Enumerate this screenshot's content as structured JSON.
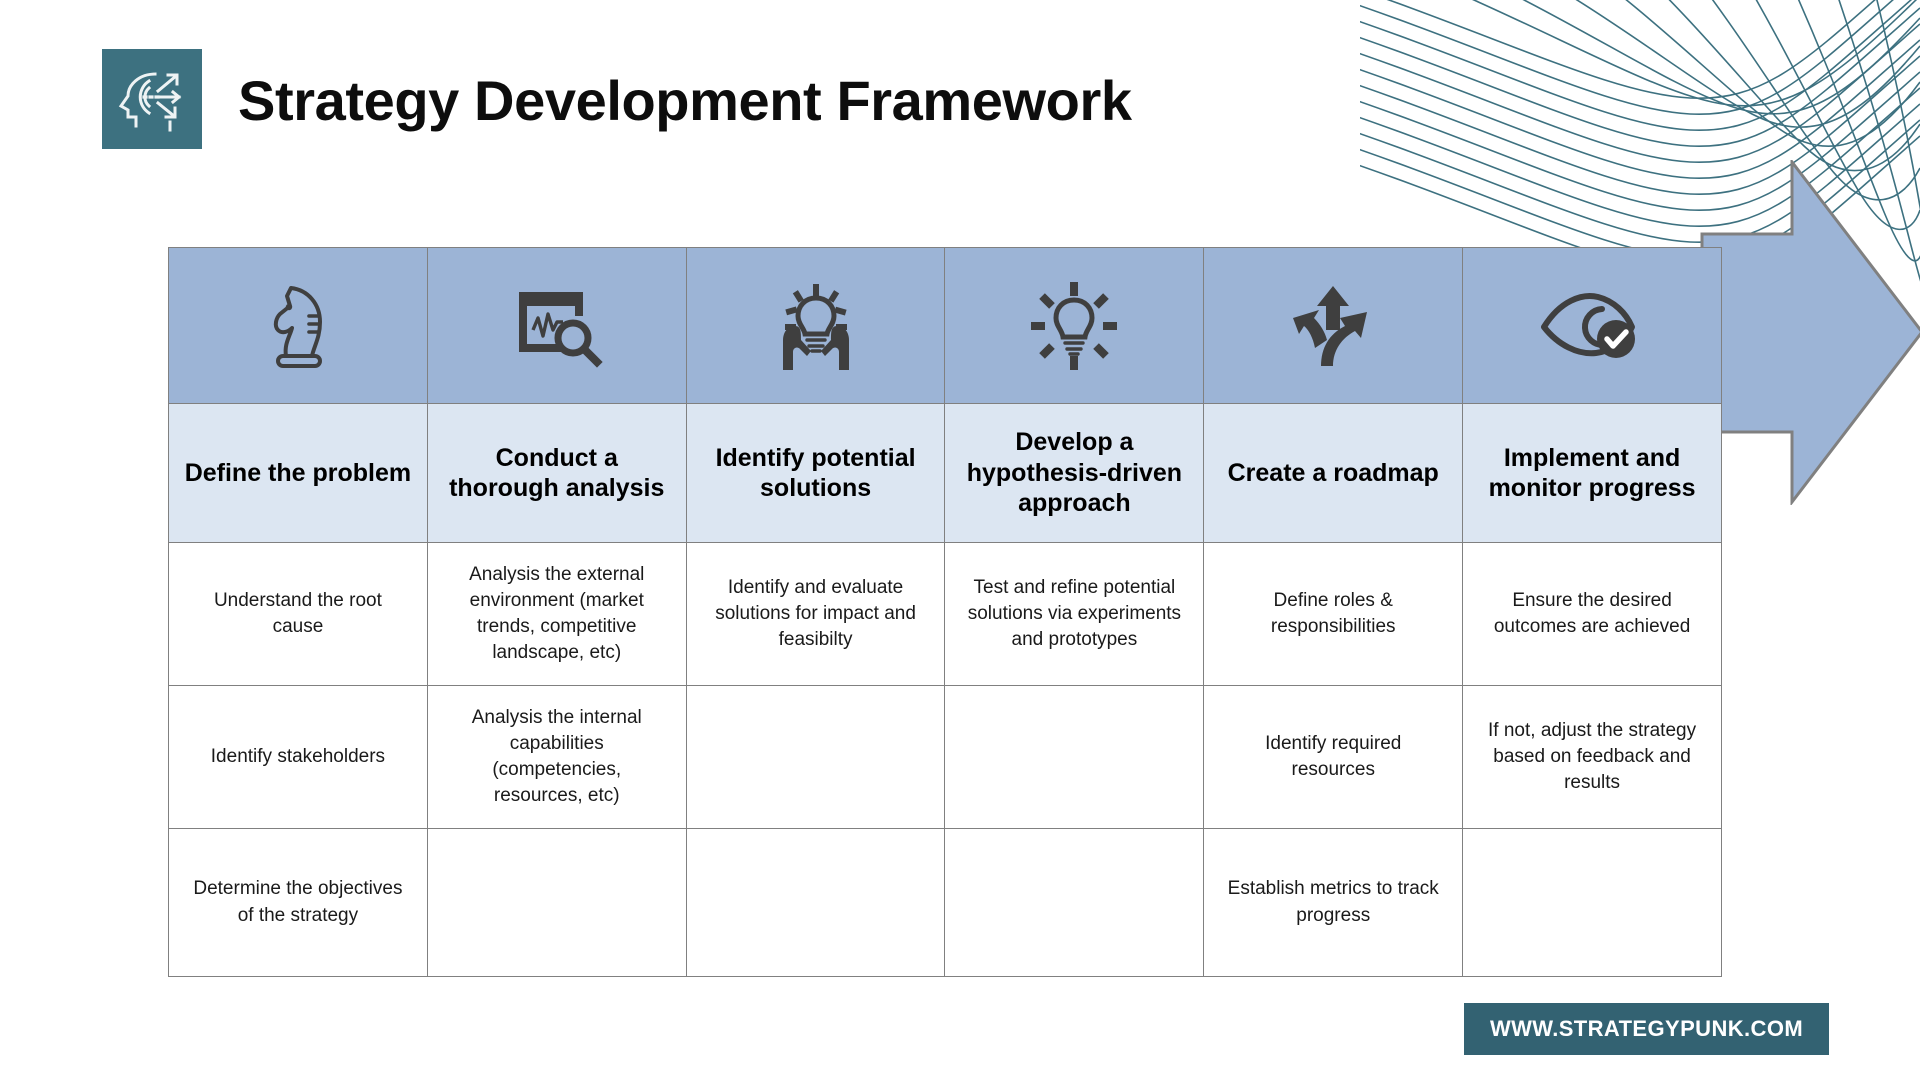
{
  "header": {
    "title": "Strategy Development Framework",
    "logo_icon": "head-arrows-icon",
    "logo_bg_color": "#3d7180"
  },
  "decoration": {
    "waves_icon": "wave-lines-decoration",
    "waves_color": "#3d7180",
    "arrow_icon": "right-arrow-shape",
    "arrow_color": "#9cb4d6",
    "arrow_border_color": "#808080"
  },
  "table": {
    "icon_row_bg": "#9cb4d6",
    "header_row_bg": "#dce6f2",
    "border_color": "#808080",
    "columns": [
      {
        "icon": "chess-knight-icon",
        "header": "Define the problem",
        "items": [
          "Understand the root cause",
          "Identify stakeholders",
          "Determine the objectives of the strategy"
        ]
      },
      {
        "icon": "chart-magnifier-icon",
        "header": "Conduct a thorough analysis",
        "items": [
          "Analysis the external environment (market trends, competitive landscape, etc)",
          "Analysis the internal capabilities (competencies, resources, etc)",
          ""
        ]
      },
      {
        "icon": "hands-lightbulb-icon",
        "header": "Identify potential solutions",
        "items": [
          "Identify and evaluate solutions for impact and feasibilty",
          "",
          ""
        ]
      },
      {
        "icon": "lightbulb-rays-icon",
        "header": "Develop a hypothesis-driven approach",
        "items": [
          "Test and refine potential solutions via experiments and prototypes",
          "",
          ""
        ]
      },
      {
        "icon": "three-way-arrows-icon",
        "header": "Create a roadmap",
        "items": [
          "Define roles & responsibilities",
          "Identify required resources",
          "Establish metrics to track progress"
        ]
      },
      {
        "icon": "eye-check-icon",
        "header": "Implement and monitor progress",
        "items": [
          "Ensure the desired outcomes are achieved",
          "If not, adjust the strategy based on feedback and results",
          ""
        ]
      }
    ]
  },
  "footer": {
    "badge_label": "WWW.STRATEGYPUNK.COM",
    "badge_color": "#336272"
  }
}
